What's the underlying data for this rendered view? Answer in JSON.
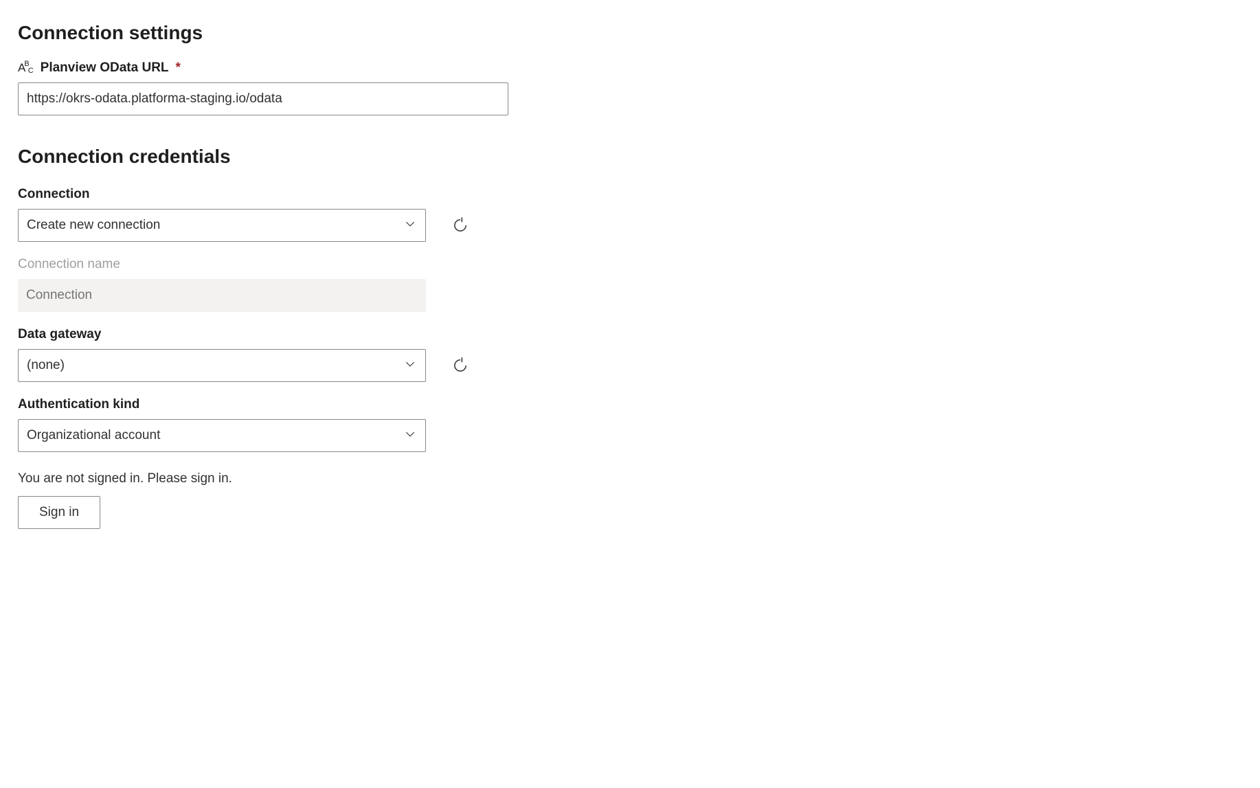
{
  "settings": {
    "heading": "Connection settings",
    "url_label": "Planview OData URL",
    "url_value": "https://okrs-odata.platforma-staging.io/odata"
  },
  "credentials": {
    "heading": "Connection credentials",
    "connection_label": "Connection",
    "connection_value": "Create new connection",
    "connection_name_label": "Connection name",
    "connection_name_placeholder": "Connection",
    "data_gateway_label": "Data gateway",
    "data_gateway_value": "(none)",
    "auth_kind_label": "Authentication kind",
    "auth_kind_value": "Organizational account",
    "signin_status": "You are not signed in. Please sign in.",
    "signin_button": "Sign in"
  }
}
